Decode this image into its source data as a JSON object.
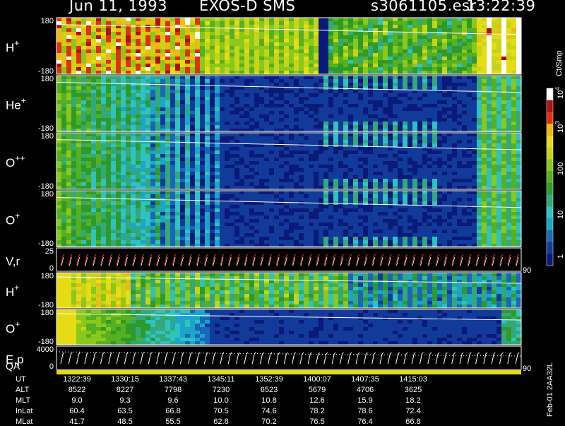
{
  "header": {
    "date": "Jun 11, 1993",
    "mission": "EXOS-D SMS",
    "file": "s3061105.esr",
    "time": "13:22:39"
  },
  "colorbar": {
    "unit": "Ct/Smp",
    "ticks": [
      "1",
      "10",
      "100",
      "10",
      "10"
    ],
    "exponents": [
      "",
      "",
      "",
      "3",
      "4"
    ],
    "colors": [
      "#0a1a78",
      "#123a9a",
      "#1a66b8",
      "#1aa6c8",
      "#2fc2c0",
      "#33a87a",
      "#2e9a2a",
      "#56b020",
      "#8ac81c",
      "#c8d418",
      "#e6dc14",
      "#f0b810",
      "#e03010",
      "#b01010",
      "#ffffff"
    ]
  },
  "chart_data": {
    "type": "heatmap",
    "panels": [
      {
        "name": "H+",
        "sup": "+",
        "base": "H",
        "ylim": [
          -180,
          180
        ],
        "yticks": [
          "180",
          "-180"
        ],
        "pattern": "h1"
      },
      {
        "name": "He+",
        "sup": "+",
        "base": "He",
        "ylim": [
          -180,
          180
        ],
        "yticks": [
          "180",
          "-180"
        ],
        "pattern": "he"
      },
      {
        "name": "O++",
        "sup": "++",
        "base": "O",
        "ylim": [
          -180,
          180
        ],
        "yticks": [
          "180",
          "-180"
        ],
        "pattern": "opp"
      },
      {
        "name": "O+",
        "sup": "+",
        "base": "O",
        "ylim": [
          -180,
          180
        ],
        "yticks": [
          "180",
          "-180"
        ],
        "pattern": "op1"
      },
      {
        "name": "V,r",
        "sup": "",
        "base": "V,r",
        "ylim": [
          0,
          25
        ],
        "yticks": [
          "25",
          "0"
        ],
        "right_tick": "90",
        "pattern": "vr"
      },
      {
        "name": "H+",
        "sup": "+",
        "base": "H",
        "ylim": [
          -180,
          180
        ],
        "yticks": [
          "180",
          "-180"
        ],
        "pattern": "h2"
      },
      {
        "name": "O+",
        "sup": "+",
        "base": "O",
        "ylim": [
          -180,
          180
        ],
        "yticks": [
          "180",
          "-180"
        ],
        "pattern": "op2"
      },
      {
        "name": "E,p",
        "sup": "",
        "base": "E,p",
        "ylim": [
          0,
          4000
        ],
        "yticks": [
          "4000",
          "0"
        ],
        "right_tick": "90",
        "pattern": "ep"
      }
    ],
    "qa_label": "QA",
    "ephemeris": {
      "rows": [
        "UT",
        "ALT",
        "MLT",
        "InLat",
        "MLat"
      ],
      "UT": [
        "1322:39",
        "1330:15",
        "1337:43",
        "1345:11",
        "1352:39",
        "1400:07",
        "1407:35",
        "1415:03"
      ],
      "ALT": [
        "8522",
        "8227",
        "7798",
        "7230",
        "6523",
        "5679",
        "4706",
        "3625"
      ],
      "MLT": [
        "9.0",
        "9.3",
        "9.6",
        "10.0",
        "10.8",
        "12.6",
        "15.9",
        "18.2"
      ],
      "InLat": [
        "60.4",
        "63.5",
        "66.8",
        "70.5",
        "74.6",
        "78.2",
        "78.6",
        "72.4"
      ],
      "MLat": [
        "41.7",
        "48.5",
        "55.5",
        "62.8",
        "70.2",
        "76.5",
        "76.4",
        "66.8"
      ]
    }
  },
  "stamp": "Feb-01 2AA32L"
}
